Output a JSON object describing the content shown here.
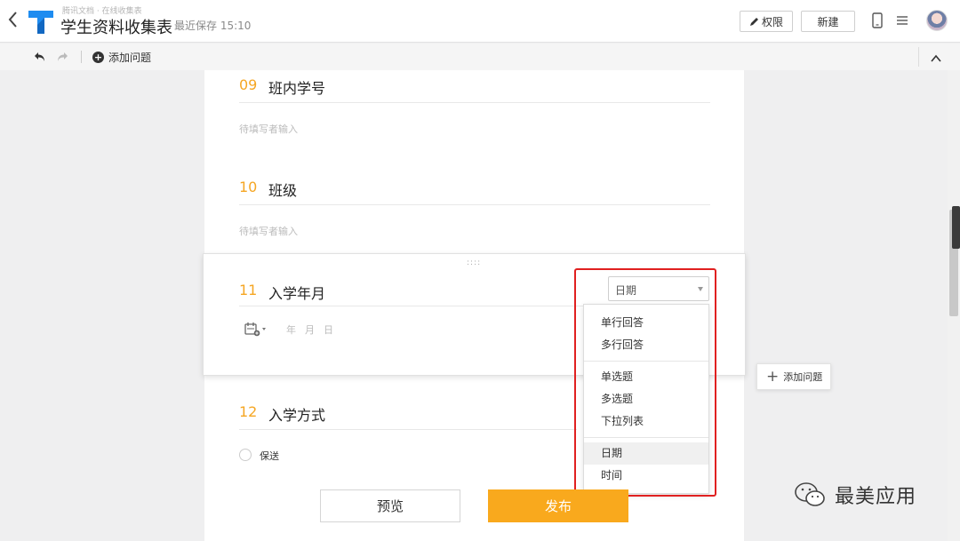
{
  "header": {
    "brand": "腾讯文档 · 在线收集表",
    "title": "学生资料收集表",
    "save_status": "最近保存 15:10",
    "permissions_label": "权限",
    "new_label": "新建"
  },
  "toolbar": {
    "add_question_label": "添加问题"
  },
  "questions": [
    {
      "num": "09",
      "title": "班内学号",
      "placeholder": "待填写者输入"
    },
    {
      "num": "10",
      "title": "班级",
      "placeholder": "待填写者输入"
    },
    {
      "num": "11",
      "title": "入学年月",
      "type_selected": "日期",
      "date_parts": [
        "年",
        "月",
        "日"
      ]
    },
    {
      "num": "12",
      "title": "入学方式",
      "option": "保送"
    }
  ],
  "dropdown": {
    "groups": [
      [
        "单行回答",
        "多行回答"
      ],
      [
        "单选题",
        "多选题",
        "下拉列表"
      ],
      [
        "日期",
        "时间"
      ]
    ],
    "selected": "日期"
  },
  "side_add_label": "添加问题",
  "buttons": {
    "preview": "预览",
    "publish": "发布"
  },
  "watermark": "最美应用",
  "colors": {
    "accent": "#f5a623",
    "publish": "#f9a91d",
    "highlight_box": "#e02020"
  }
}
